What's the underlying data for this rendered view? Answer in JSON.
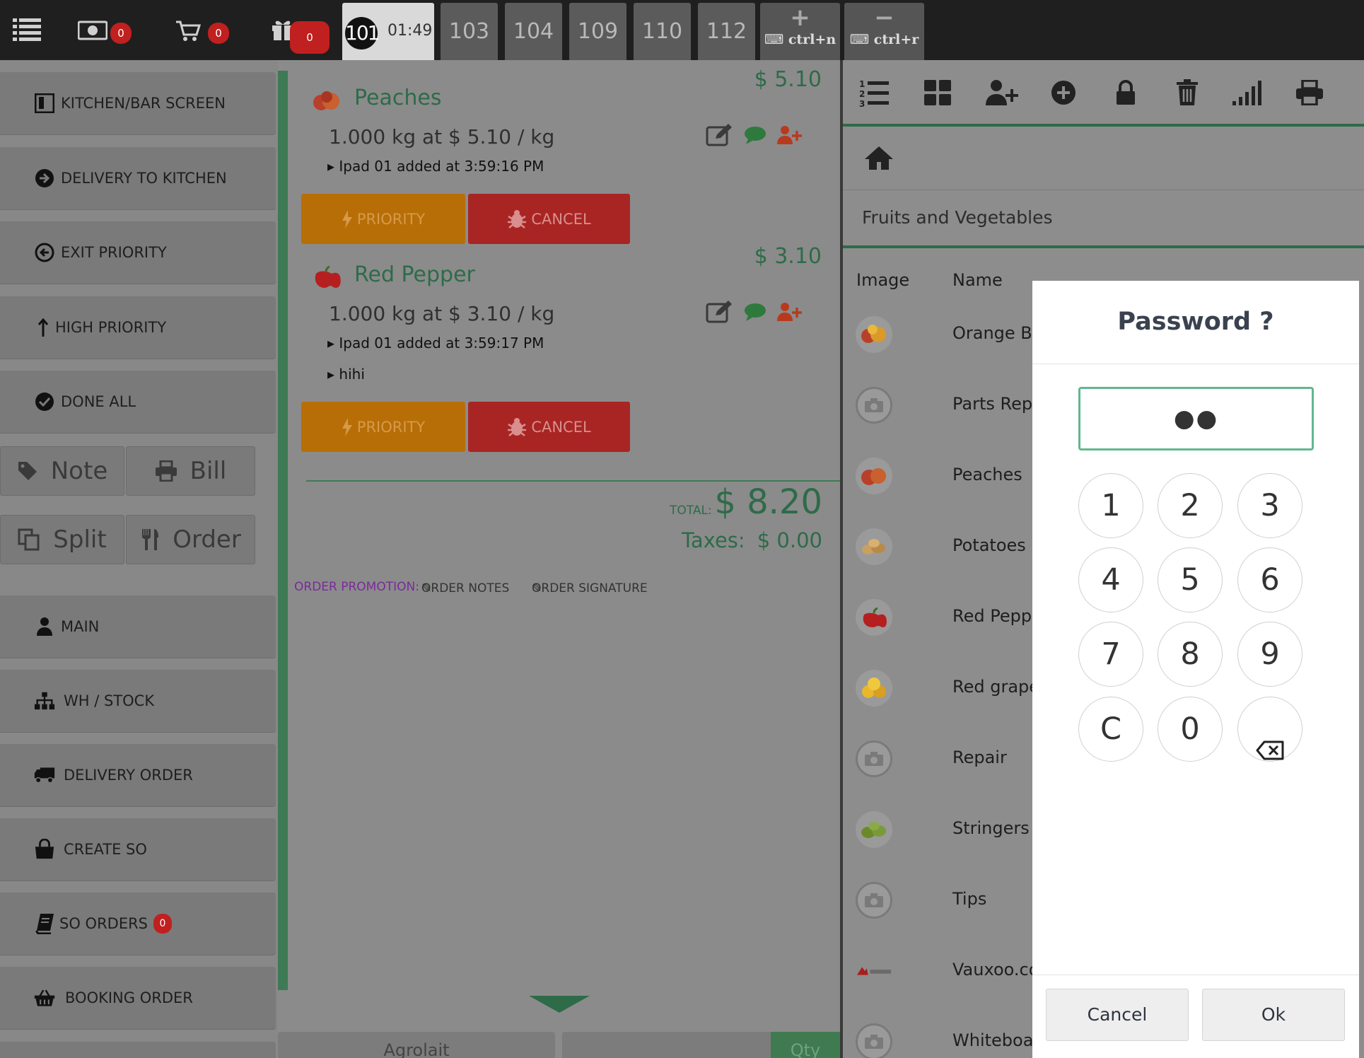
{
  "topbar": {
    "cash_badge": "0",
    "cart_badge": "0",
    "gift_badge": "0",
    "tabs": [
      {
        "label": "103"
      },
      {
        "label": "104"
      },
      {
        "label": "109"
      },
      {
        "label": "110"
      },
      {
        "label": "112"
      }
    ],
    "active_tab": {
      "number": "101",
      "time": "01:49"
    },
    "new_order": {
      "symbol": "+",
      "shortcut": "ctrl+n"
    },
    "remove_order": {
      "symbol": "−",
      "shortcut": "ctrl+r"
    }
  },
  "leftmenu": {
    "kitchen_bar": "KITCHEN/BAR SCREEN",
    "delivery_kitchen": "DELIVERY TO KITCHEN",
    "exit_priority": "EXIT PRIORITY",
    "high_priority": "HIGH PRIORITY",
    "done_all": "DONE ALL",
    "note": "Note",
    "bill": "Bill",
    "split": "Split",
    "order": "Order",
    "main": "MAIN",
    "wh_stock": "WH / STOCK",
    "delivery_order": "DELIVERY ORDER",
    "create_so": "CREATE SO",
    "so_orders": "SO ORDERS",
    "so_orders_badge": "0",
    "booking_order": "BOOKING ORDER"
  },
  "order": {
    "lines": [
      {
        "name": "Peaches",
        "price": "$ 5.10",
        "qty": "1.000 kg at $ 5.10 / kg",
        "added": "Ipad 01 added at 3:59:16 PM",
        "note": "",
        "priority_label": "PRIORITY",
        "cancel_label": "CANCEL"
      },
      {
        "name": "Red Pepper",
        "price": "$ 3.10",
        "qty": "1.000 kg at $ 3.10 / kg",
        "added": "Ipad 01 added at 3:59:17 PM",
        "note": "hihi",
        "priority_label": "PRIORITY",
        "cancel_label": "CANCEL"
      }
    ],
    "total_label": "TOTAL:",
    "total_value": "$ 8.20",
    "taxes_label": "Taxes:",
    "taxes_value": "$ 0.00",
    "promotion_label": "ORDER PROMOTION:",
    "notes_label": "ORDER NOTES",
    "signature_label": "ORDER SIGNATURE",
    "customer_label": "Agrolait",
    "qty_label": "Qty"
  },
  "products": {
    "category": "Fruits and Vegetables",
    "col_image": "Image",
    "col_name": "Name",
    "items": [
      {
        "name": "Orange Bu"
      },
      {
        "name": "Parts Rep"
      },
      {
        "name": "Peaches"
      },
      {
        "name": "Potatoes"
      },
      {
        "name": "Red Peppe"
      },
      {
        "name": "Red grape"
      },
      {
        "name": "Repair"
      },
      {
        "name": "Stringers"
      },
      {
        "name": "Tips"
      },
      {
        "name": "Vauxoo.co"
      },
      {
        "name": "Whiteboa"
      }
    ]
  },
  "password_dialog": {
    "title": "Password ?",
    "masked_value": "●●",
    "keys": [
      "1",
      "2",
      "3",
      "4",
      "5",
      "6",
      "7",
      "8",
      "9",
      "C",
      "0"
    ],
    "cancel_label": "Cancel",
    "ok_label": "Ok"
  },
  "colors": {
    "accent_green": "#2e6b49",
    "priority_orange": "#b86e07",
    "cancel_red": "#a82524",
    "badge_red": "#c0201f",
    "input_border": "#61b88f"
  }
}
